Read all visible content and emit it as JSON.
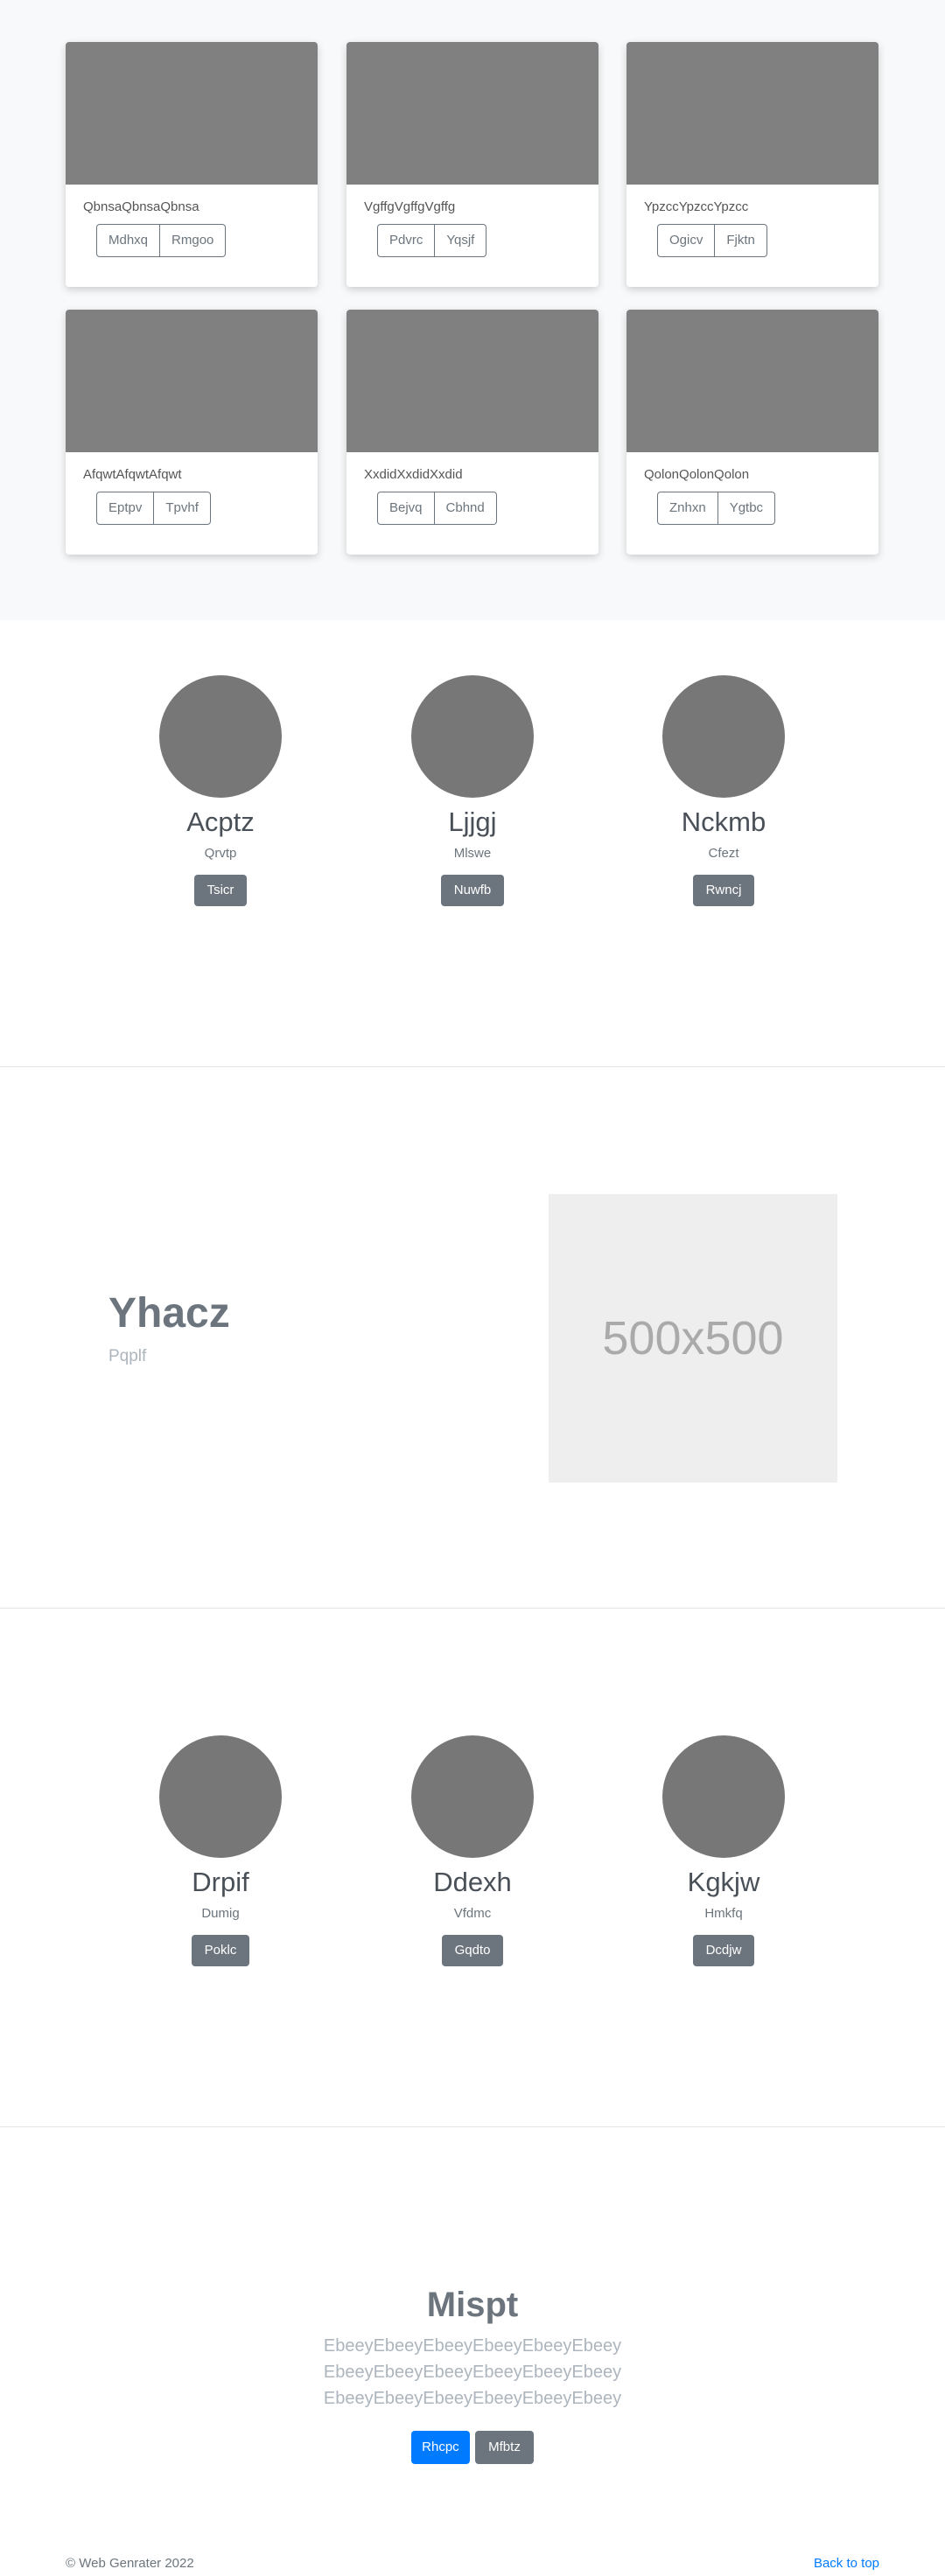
{
  "album": {
    "cards": [
      {
        "text": "QbnsaQbnsaQbnsa",
        "buttons": [
          "Mdhxq",
          "Rmgoo"
        ]
      },
      {
        "text": "VgffgVgffgVgffg",
        "buttons": [
          "Pdvrc",
          "Yqsjf"
        ]
      },
      {
        "text": "YpzccYpzccYpzcc",
        "buttons": [
          "Ogicv",
          "Fjktn"
        ]
      },
      {
        "text": "AfqwtAfqwtAfqwt",
        "buttons": [
          "Eptpv",
          "Tpvhf"
        ]
      },
      {
        "text": "XxdidXxdidXxdid",
        "buttons": [
          "Bejvq",
          "Cbhnd"
        ]
      },
      {
        "text": "QolonQolonQolon",
        "buttons": [
          "Znhxn",
          "Ygtbc"
        ]
      }
    ]
  },
  "team1": {
    "members": [
      {
        "name": "Acptz",
        "role": "Qrvtp",
        "button": "Tsicr"
      },
      {
        "name": "Ljjgj",
        "role": "Mlswe",
        "button": "Nuwfb"
      },
      {
        "name": "Nckmb",
        "role": "Cfezt",
        "button": "Rwncj"
      }
    ]
  },
  "feature": {
    "title": "Yhacz",
    "subtitle": "Pqplf",
    "placeholder": "500x500"
  },
  "team2": {
    "members": [
      {
        "name": "Drpif",
        "role": "Dumig",
        "button": "Poklc"
      },
      {
        "name": "Ddexh",
        "role": "Vfdmc",
        "button": "Gqdto"
      },
      {
        "name": "Kgkjw",
        "role": "Hmkfq",
        "button": "Dcdjw"
      }
    ]
  },
  "jumbotron": {
    "title": "Mispt",
    "lead": [
      "EbeeyEbeeyEbeeyEbeeyEbeeyEbeey",
      "EbeeyEbeeyEbeeyEbeeyEbeeyEbeey",
      "EbeeyEbeeyEbeeyEbeeyEbeeyEbeey"
    ],
    "primary_button": "Rhcpc",
    "secondary_button": "Mfbtz"
  },
  "footer": {
    "copyright": "© Web Genrater 2022",
    "back_to_top": "Back to top"
  },
  "colors": {
    "primary": "#007bff",
    "secondary": "#6c757d",
    "thumb": "#808080",
    "avatar": "#777777",
    "album_bg": "#f8f9fa"
  }
}
